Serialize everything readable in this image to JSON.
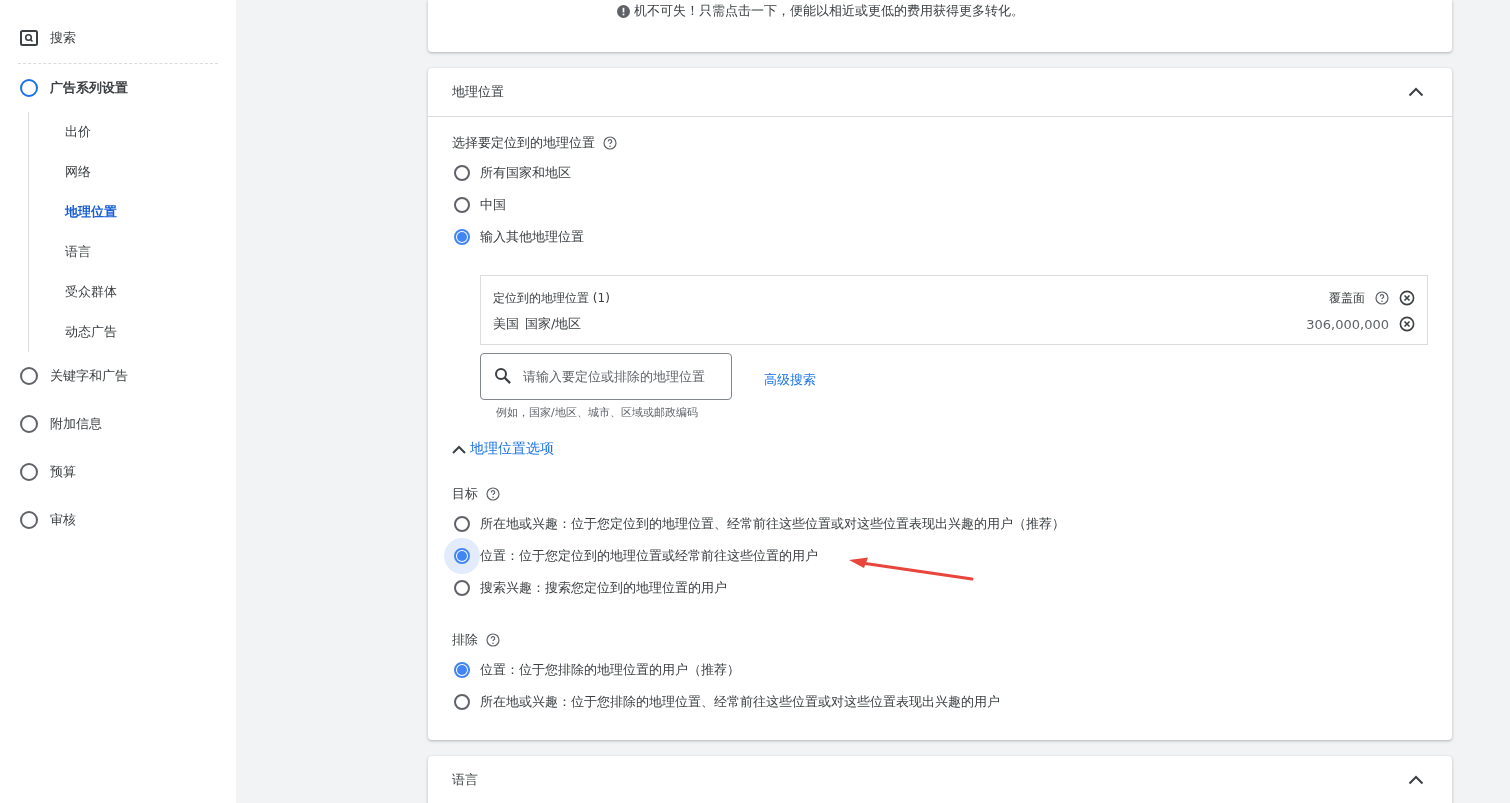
{
  "sidebar": {
    "items": [
      {
        "kind": "search",
        "label": "搜索"
      },
      {
        "kind": "step",
        "label": "广告系列设置",
        "selected": true,
        "children": [
          {
            "label": "出价",
            "selected": false
          },
          {
            "label": "网络",
            "selected": false
          },
          {
            "label": "地理位置",
            "selected": true
          },
          {
            "label": "语言",
            "selected": false
          },
          {
            "label": "受众群体",
            "selected": false
          },
          {
            "label": "动态广告",
            "selected": false
          }
        ]
      },
      {
        "kind": "step",
        "label": "关键字和广告",
        "selected": false
      },
      {
        "kind": "step",
        "label": "附加信息",
        "selected": false
      },
      {
        "kind": "step",
        "label": "预算",
        "selected": false
      },
      {
        "kind": "step",
        "label": "审核",
        "selected": false
      }
    ]
  },
  "notice": {
    "text": "机不可失！只需点击一下，便能以相近或更低的费用获得更多转化。"
  },
  "location_card": {
    "title": "地理位置",
    "expanded": true,
    "select_label": "选择要定位到的地理位置",
    "options": [
      {
        "label": "所有国家和地区",
        "selected": false
      },
      {
        "label": "中国",
        "selected": false
      },
      {
        "label": "输入其他地理位置",
        "selected": true
      }
    ],
    "targeted": {
      "heading": "定位到的地理位置 (1)",
      "reach_label": "覆盖面",
      "rows": [
        {
          "name": "美国",
          "type": "国家/地区",
          "reach": "306,000,000"
        }
      ]
    },
    "search": {
      "placeholder": "请输入要定位或排除的地理位置",
      "hint": "例如，国家/地区、城市、区域或邮政编码"
    },
    "advanced_search": "高级搜索",
    "options_toggle": {
      "label": "地理位置选项",
      "expanded": true
    },
    "target_label": "目标",
    "target_options": [
      {
        "label": "所在地或兴趣：位于您定位到的地理位置、经常前往这些位置或对这些位置表现出兴趣的用户（推荐）",
        "selected": false,
        "focused": false
      },
      {
        "label": "位置：位于您定位到的地理位置或经常前往这些位置的用户",
        "selected": true,
        "focused": true
      },
      {
        "label": "搜索兴趣：搜索您定位到的地理位置的用户",
        "selected": false,
        "focused": false
      }
    ],
    "exclude_label": "排除",
    "exclude_options": [
      {
        "label": "位置：位于您排除的地理位置的用户（推荐）",
        "selected": true,
        "focused": false
      },
      {
        "label": "所在地或兴趣：位于您排除的地理位置、经常前往这些位置或对这些位置表现出兴趣的用户",
        "selected": false,
        "focused": false
      }
    ]
  },
  "language_card": {
    "title": "语言",
    "expanded": true
  }
}
